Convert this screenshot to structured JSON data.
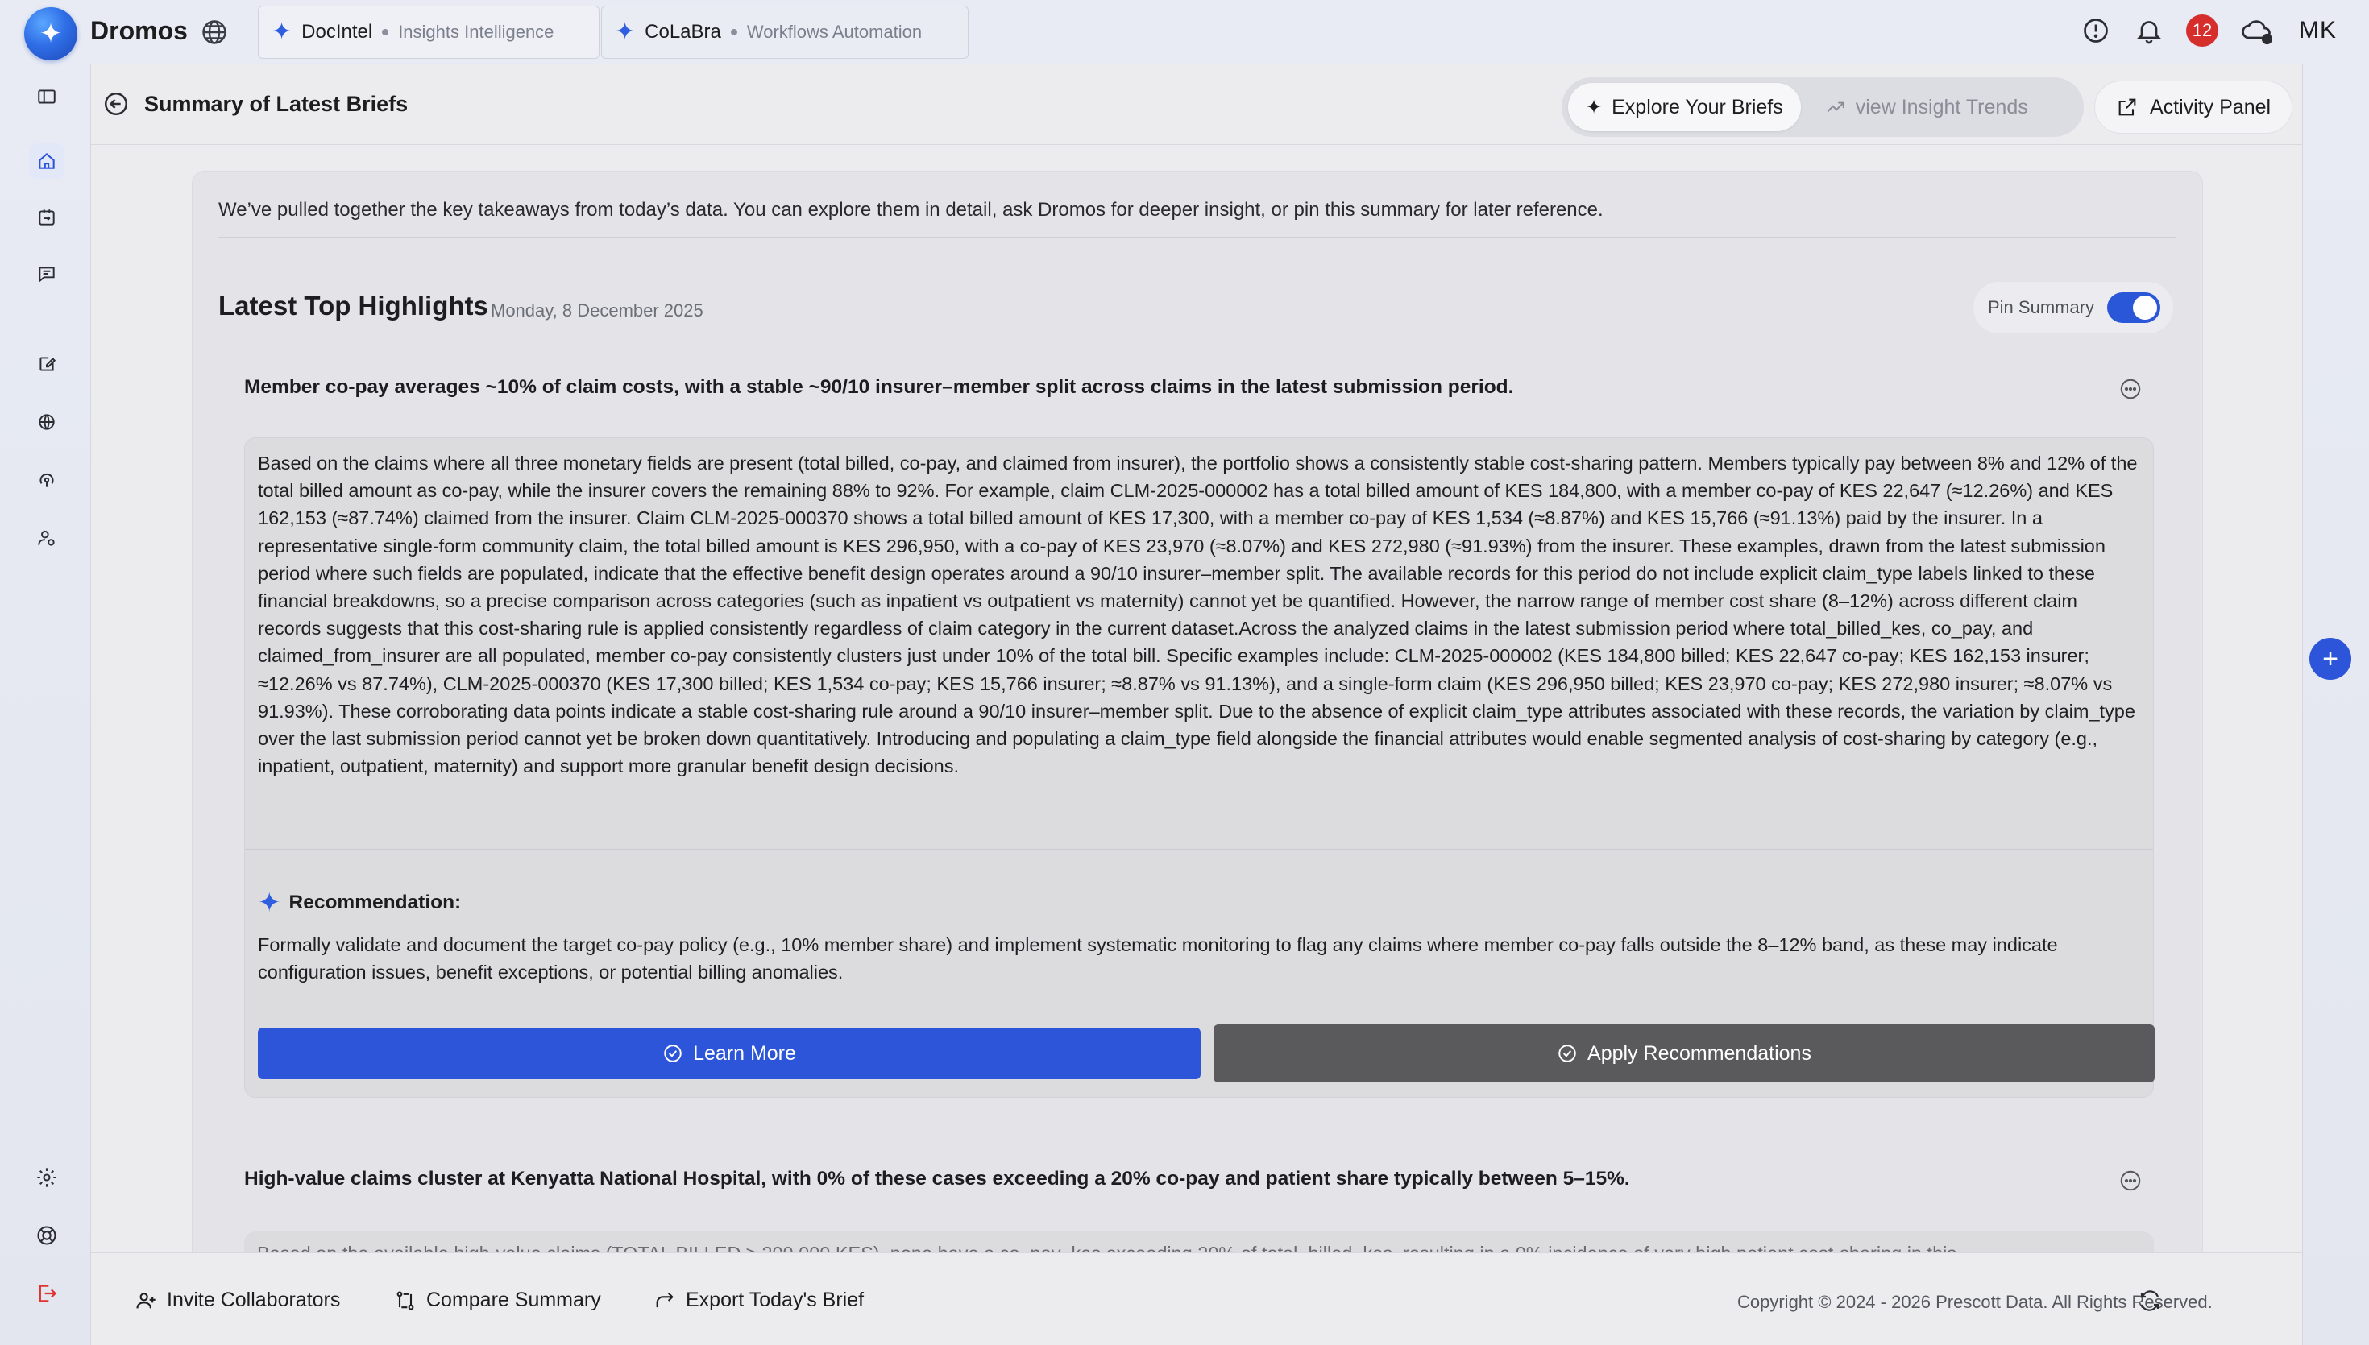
{
  "brand": {
    "name": "Dromos"
  },
  "tabs": [
    {
      "name": "DocIntel",
      "subtitle": "Insights Intelligence"
    },
    {
      "name": "CoLaBra",
      "subtitle": "Workflows Automation"
    }
  ],
  "topbar": {
    "notification_count": "12",
    "user_initials": "MK"
  },
  "header": {
    "title": "Summary of Latest Briefs",
    "explore_label": "Explore Your Briefs",
    "trends_label": "view Insight Trends",
    "activity_label": "Activity Panel"
  },
  "intro": "We’ve pulled together the key takeaways from today’s data. You can explore them in detail, ask Dromos for deeper insight, or pin this summary for later reference.",
  "highlights": {
    "title": "Latest Top Highlights",
    "date": "Monday, 8 December 2025",
    "pin_label": "Pin Summary",
    "pin_on": true
  },
  "insights": [
    {
      "title": "Member co-pay averages ~10% of claim costs, with a stable ~90/10 insurer–member split across claims in the latest submission period.",
      "body": "Based on the claims where all three monetary fields are present (total billed, co-pay, and claimed from insurer), the portfolio shows a consistently stable cost-sharing pattern. Members typically pay between 8% and 12% of the total billed amount as co-pay, while the insurer covers the remaining 88% to 92%. For example, claim CLM-2025-000002 has a total billed amount of KES 184,800, with a member co-pay of KES 22,647 (≈12.26%) and KES 162,153 (≈87.74%) claimed from the insurer. Claim CLM-2025-000370 shows a total billed amount of KES 17,300, with a member co-pay of KES 1,534 (≈8.87%) and KES 15,766 (≈91.13%) paid by the insurer. In a representative single-form community claim, the total billed amount is KES 296,950, with a co-pay of KES 23,970 (≈8.07%) and KES 272,980 (≈91.93%) from the insurer. These examples, drawn from the latest submission period where such fields are populated, indicate that the effective benefit design operates around a 90/10 insurer–member split. The available records for this period do not include explicit claim_type labels linked to these financial breakdowns, so a precise comparison across categories (such as inpatient vs outpatient vs maternity) cannot yet be quantified. However, the narrow range of member cost share (8–12%) across different claim records suggests that this cost-sharing rule is applied consistently regardless of claim category in the current dataset.Across the analyzed claims in the latest submission period where total_billed_kes, co_pay, and claimed_from_insurer are all populated, member co-pay consistently clusters just under 10% of the total bill. Specific examples include: CLM-2025-000002 (KES 184,800 billed; KES 22,647 co-pay; KES 162,153 insurer; ≈12.26% vs 87.74%), CLM-2025-000370 (KES 17,300 billed; KES 1,534 co-pay; KES 15,766 insurer; ≈8.87% vs 91.13%), and a single-form claim (KES 296,950 billed; KES 23,970 co-pay; KES 272,980 insurer; ≈8.07% vs 91.93%). These corroborating data points indicate a stable cost-sharing rule around a 90/10 insurer–member split. Due to the absence of explicit claim_type attributes associated with these records, the variation by claim_type over the last submission period cannot yet be broken down quantitatively. Introducing and populating a claim_type field alongside the financial attributes would enable segmented analysis of cost-sharing by category (e.g., inpatient, outpatient, maternity) and support more granular benefit design decisions.",
      "recommendation_label": "Recommendation:",
      "recommendation": "Formally validate and document the target co-pay policy (e.g., 10% member share) and implement systematic monitoring to flag any claims where member co-pay falls outside the 8–12% band, as these may indicate configuration issues, benefit exceptions, or potential billing anomalies.",
      "learn_more_label": "Learn More",
      "apply_label": "Apply Recommendations"
    },
    {
      "title": "High-value claims cluster at Kenyatta National Hospital, with 0% of these cases exceeding a 20% co-pay and patient share typically between 5–15%.",
      "body_preview": "Based on the available high-value claims (TOTAL BILLED ≥ 200,000 KES), none have a co_pay_kes exceeding 20% of total_billed_kes, resulting in a 0% incidence of very high patient cost-sharing in this"
    }
  ],
  "footer": {
    "invite_label": "Invite Collaborators",
    "compare_label": "Compare Summary",
    "export_label": "Export Today's Brief",
    "copyright": "Copyright © 2024 - 2026 Prescott Data. All Rights Reserved."
  },
  "colors": {
    "accent": "#2d55d9",
    "apply_button": "#5a5a5c",
    "badge": "#d62d2d"
  }
}
